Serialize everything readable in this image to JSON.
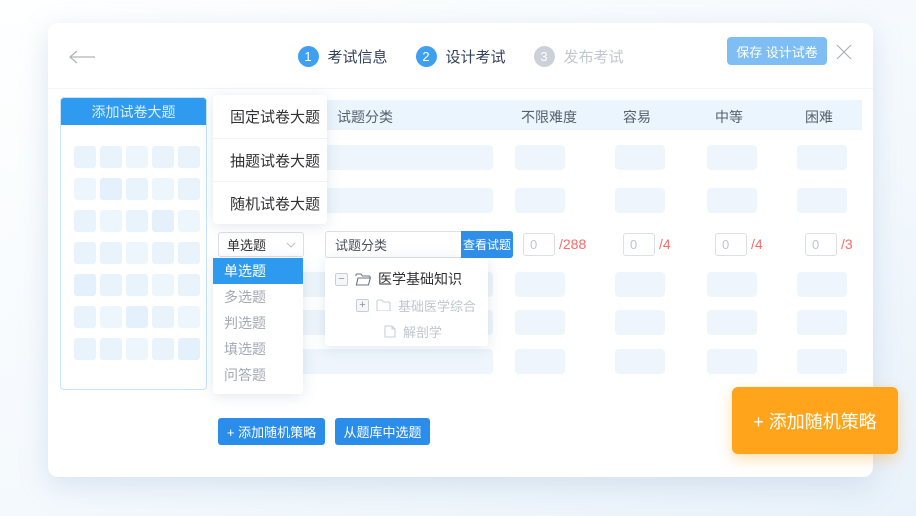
{
  "header": {
    "steps": [
      {
        "num": "1",
        "label": "考试信息"
      },
      {
        "num": "2",
        "label": "设计考试"
      },
      {
        "num": "3",
        "label": "发布考试"
      }
    ],
    "save_label": "保存 设计试卷"
  },
  "sidebar": {
    "add_section_label": "添加试卷大题"
  },
  "section_type_menu": {
    "items": [
      "固定试卷大题",
      "抽题试卷大题",
      "随机试卷大题"
    ]
  },
  "table": {
    "columns": [
      "试题分类",
      "不限难度",
      "容易",
      "中等",
      "困难"
    ]
  },
  "strategy_row": {
    "question_type": {
      "selected": "单选题",
      "options": [
        "单选题",
        "多选题",
        "判选题",
        "填选题",
        "问答题"
      ]
    },
    "category_input": "试题分类",
    "view_questions_label": "查看试题",
    "counts": [
      {
        "value": "0",
        "total": "/288"
      },
      {
        "value": "0",
        "total": "/4"
      },
      {
        "value": "0",
        "total": "/4"
      },
      {
        "value": "0",
        "total": "/3"
      }
    ]
  },
  "category_tree": {
    "items": [
      {
        "label": "医学基础知识"
      },
      {
        "label": "基础医学综合"
      },
      {
        "label": "解剖学"
      }
    ]
  },
  "actions": {
    "add_random_strategy": "+ 添加随机策略",
    "pick_from_bank": "从题库中选题",
    "add_random_strategy_cta": "+ 添加随机策略"
  },
  "colors": {
    "accent_blue": "#2f9bf0",
    "button_blue": "#2b8dea",
    "save_button_blue": "#7fbef4",
    "header_row_blue": "#ebf5fd",
    "orange_cta": "#ffa41b",
    "count_red": "#f56c6c"
  }
}
